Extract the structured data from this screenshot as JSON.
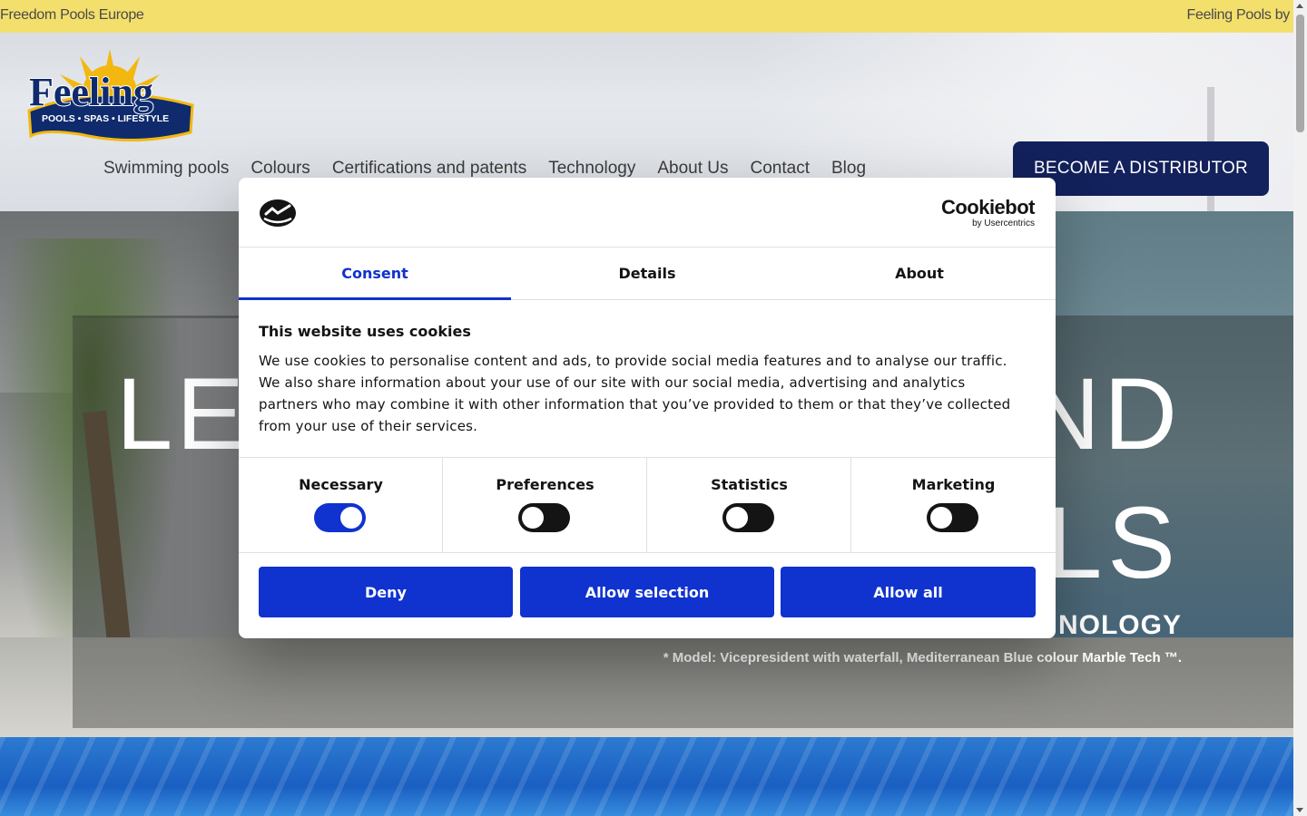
{
  "topbar": {
    "left_text": "Freedom Pools Europe",
    "right_text": "Feeling Pools by"
  },
  "logo": {
    "word": "Feeling",
    "tagline": "POOLS • SPAS • LIFESTYLE"
  },
  "nav": {
    "items": [
      "Swimming pools",
      "Colours",
      "Certifications and patents",
      "Technology",
      "About Us",
      "Contact",
      "Blog"
    ],
    "cta": "BECOME A DISTRIBUTOR"
  },
  "hero": {
    "line1_left": "LE",
    "line1_right": "ND",
    "line2_right": "LS",
    "subtitle": "NOLOGY",
    "caption": "* Model: Vicepresident with waterfall, Mediterranean Blue colour Marble Tech ™."
  },
  "cookie_dialog": {
    "brand_name": "Cookiebot",
    "brand_sub": "by Usercentrics",
    "tabs": [
      "Consent",
      "Details",
      "About"
    ],
    "title": "This website uses cookies",
    "text": "We use cookies to personalise content and ads, to provide social media features and to analyse our traffic. We also share information about your use of our site with our social media, advertising and analytics partners who may combine it with other information that you’ve provided to them or that they’ve collected from your use of their services.",
    "categories": [
      {
        "label": "Necessary",
        "on": true
      },
      {
        "label": "Preferences",
        "on": false
      },
      {
        "label": "Statistics",
        "on": false
      },
      {
        "label": "Marketing",
        "on": false
      }
    ],
    "buttons": {
      "deny": "Deny",
      "selection": "Allow selection",
      "all": "Allow all"
    }
  },
  "colors": {
    "accent": "#1032cf",
    "navy": "#13215c",
    "banner": "#f3df6c"
  }
}
